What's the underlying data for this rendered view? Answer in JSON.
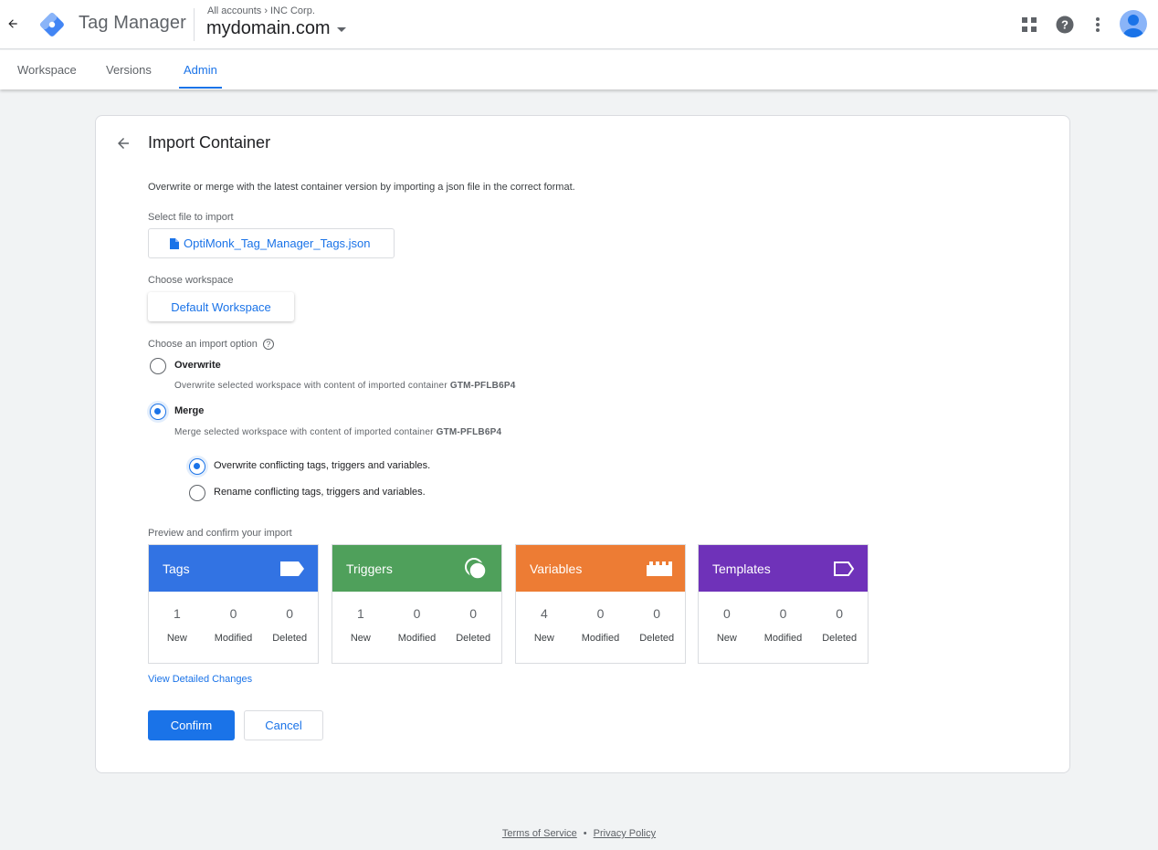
{
  "header": {
    "app_title": "Tag Manager",
    "breadcrumb_root": "All accounts",
    "breadcrumb_account": "INC Corp.",
    "container_name": "mydomain.com"
  },
  "tabs": [
    {
      "label": "Workspace",
      "active": false
    },
    {
      "label": "Versions",
      "active": false
    },
    {
      "label": "Admin",
      "active": true
    }
  ],
  "page": {
    "title": "Import Container",
    "description": "Overwrite or merge with the latest container version by importing a json file in the correct format.",
    "file_label": "Select file to import",
    "file_name": "OptiMonk_Tag_Manager_Tags.json",
    "workspace_label": "Choose workspace",
    "workspace_value": "Default Workspace",
    "import_option_label": "Choose an import option",
    "overwrite": {
      "title": "Overwrite",
      "desc": "Overwrite selected workspace with content of imported container",
      "container_id": "GTM-PFLB6P4",
      "selected": false
    },
    "merge": {
      "title": "Merge",
      "desc": "Merge selected workspace with content of imported container",
      "container_id": "GTM-PFLB6P4",
      "selected": true
    },
    "merge_options": [
      {
        "label": "Overwrite conflicting tags, triggers and variables.",
        "selected": true
      },
      {
        "label": "Rename conflicting tags, triggers and variables.",
        "selected": false
      }
    ],
    "preview_label": "Preview and confirm your import",
    "summary": [
      {
        "name": "Tags",
        "color": "#3273e3",
        "icon": "tag-icon",
        "new": "1",
        "modified": "0",
        "deleted": "0"
      },
      {
        "name": "Triggers",
        "color": "#4fa05b",
        "icon": "trigger-icon",
        "new": "1",
        "modified": "0",
        "deleted": "0"
      },
      {
        "name": "Variables",
        "color": "#ed7c34",
        "icon": "variable-icon",
        "new": "4",
        "modified": "0",
        "deleted": "0"
      },
      {
        "name": "Templates",
        "color": "#6f32b9",
        "icon": "template-icon",
        "new": "0",
        "modified": "0",
        "deleted": "0"
      }
    ],
    "col_new": "New",
    "col_modified": "Modified",
    "col_deleted": "Deleted",
    "detail_link": "View Detailed Changes",
    "confirm_label": "Confirm",
    "cancel_label": "Cancel"
  },
  "footer": {
    "terms": "Terms of Service",
    "separator": "•",
    "privacy": "Privacy Policy"
  }
}
